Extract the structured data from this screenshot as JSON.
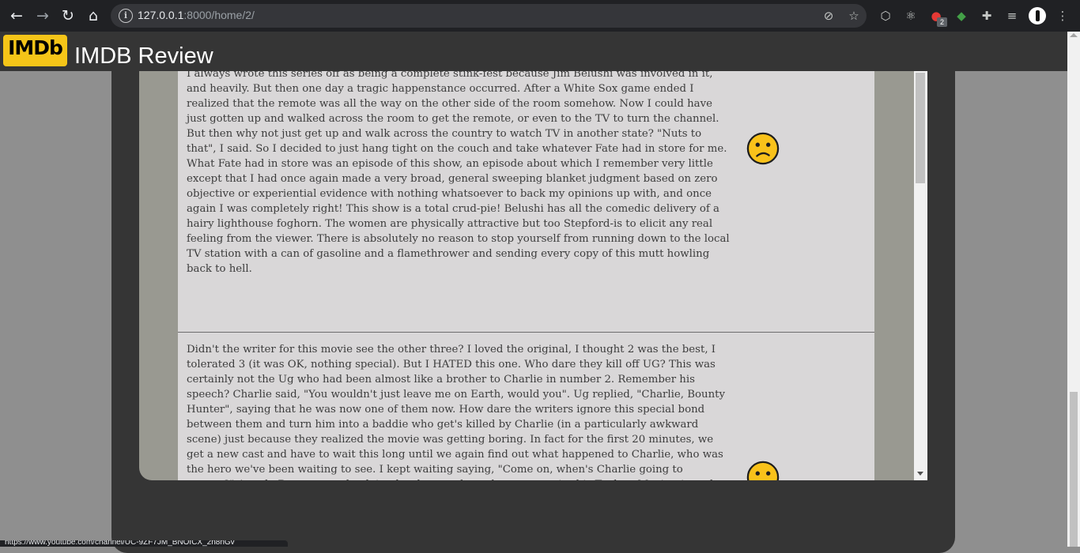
{
  "browser": {
    "url_host": "127.0.0.1",
    "url_path": ":8000/home/2/",
    "extension_badge": "2"
  },
  "header": {
    "logo_text": "IMDb",
    "title": "IMDB Review"
  },
  "reviews": [
    {
      "text": "I always wrote this series off as being a complete stink-fest because Jim Belushi was involved in it, and heavily. But then one day a tragic happenstance occurred. After a White Sox game ended I realized that the remote was all the way on the other side of the room somehow. Now I could have just gotten up and walked across the room to get the remote, or even to the TV to turn the channel. But then why not just get up and walk across the country to watch TV in another state? \"Nuts to that\", I said. So I decided to just hang tight on the couch and take whatever Fate had in store for me. What Fate had in store was an episode of this show, an episode about which I remember very little except that I had once again made a very broad, general sweeping blanket judgment based on zero objective or experiential evidence with nothing whatsoever to back my opinions up with, and once again I was completely right! This show is a total crud-pie! Belushi has all the comedic delivery of a hairy lighthouse foghorn. The women are physically attractive but too Stepford-is to elicit any real feeling from the viewer. There is absolutely no reason to stop yourself from running down to the local TV station with a can of gasoline and a flamethrower and sending every copy of this mutt howling back to hell.",
      "sentiment": "negative"
    },
    {
      "text": "Didn't the writer for this movie see the other three? I loved the original, I thought 2 was the best, I tolerated 3 (it was OK, nothing special). But I HATED this one. Who dare they kill off UG? This was certainly not the Ug who had been almost like a brother to Charlie in number 2. Remember his speech? Charlie said, \"You wouldn't just leave me on Earth, would you\". Ug replied, \"Charlie, Bounty Hunter\", saying that he was now one of them now. How dare the writers ignore this special bond between them and turn him into a baddie who get's killed by Charlie (in a particularly awkward scene) just because they realized the movie was getting boring. In fact for the first 20 minutes, we get a new cast and have to wait this long until we again find out what happened to Charlie, who was the hero we've been waiting to see. I kept waiting saying, \"Come on, when's Charlie going to appear?\" Angela Basset must be doing her best to deny she was ever in this Turkey. Moving it to the future eliminates the possibility of ever seeing a sequel with the original cast or in our time. I think the writers decided, that their movie was going to be the last and they could do whatever they wanted. This movie is totally out of line with the first two. And it didn't even seem like it was",
      "sentiment": "negative"
    }
  ],
  "status_link": "https://www.youtube.com/channel/UC-9ZF7JM_BNOfCX_2n8nGv"
}
